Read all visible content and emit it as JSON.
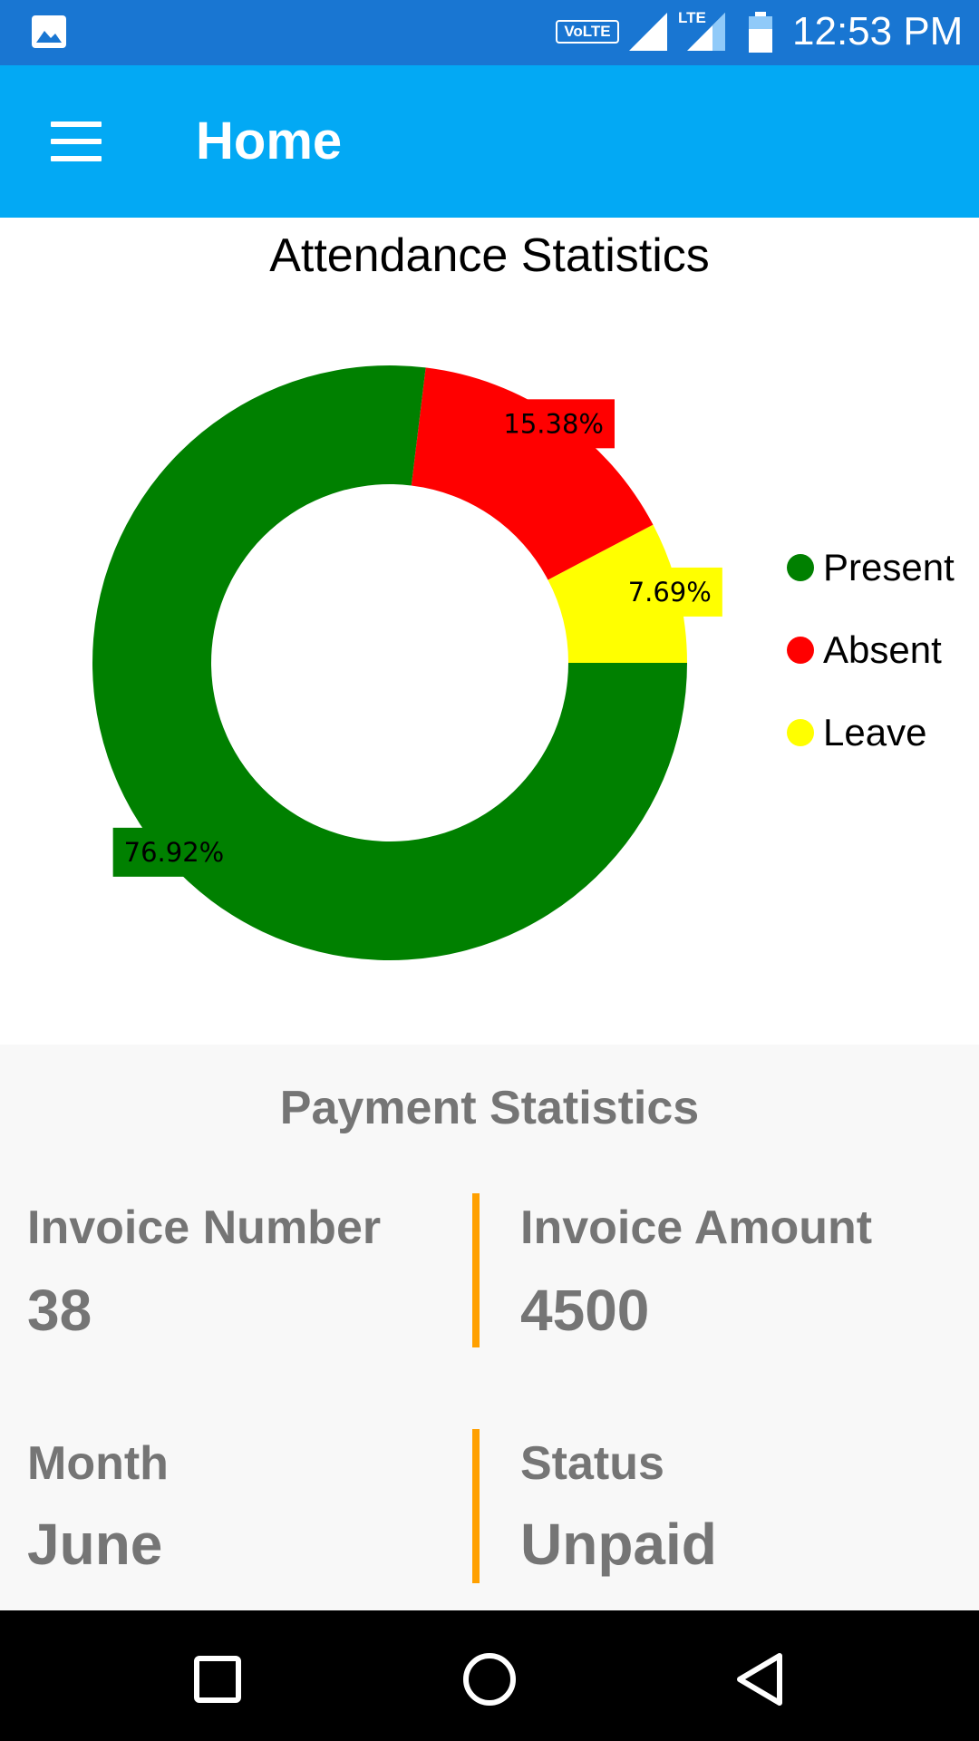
{
  "status_bar": {
    "volte": "VoLTE",
    "lte": "LTE",
    "time": "12:53 PM"
  },
  "app_bar": {
    "title": "Home",
    "menu_icon": "hamburger-menu-icon"
  },
  "attendance": {
    "title": "Attendance Statistics"
  },
  "chart_data": {
    "type": "pie",
    "title": "Attendance Statistics",
    "donut": true,
    "categories": [
      "Present",
      "Absent",
      "Leave"
    ],
    "values": [
      76.92,
      15.38,
      7.69
    ],
    "labels": [
      "76.92%",
      "15.38%",
      "7.69%"
    ],
    "colors": [
      "#008000",
      "#ff0000",
      "#ffff00"
    ],
    "legend": "right"
  },
  "payment": {
    "title": "Payment Statistics",
    "invoice_number_label": "Invoice Number",
    "invoice_number_value": "38",
    "invoice_amount_label": "Invoice Amount",
    "invoice_amount_value": "4500",
    "month_label": "Month",
    "month_value": "June",
    "status_label": "Status",
    "status_value": "Unpaid",
    "divider_color": "#ffa000"
  },
  "nav_bar": {
    "icons": [
      "recent-apps-icon",
      "home-icon",
      "back-icon"
    ]
  }
}
